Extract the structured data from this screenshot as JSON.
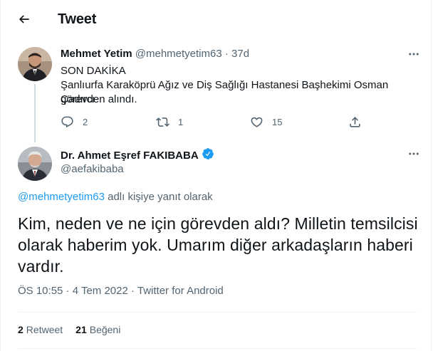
{
  "header": {
    "title": "Tweet",
    "back_icon": "arrow-left-icon"
  },
  "parent_tweet": {
    "name": "Mehmet Yetim",
    "handle": "@mehmetyetim63",
    "separator": " · ",
    "time": "37d",
    "text_lines": [
      "SON DAKİKA",
      "Şanlıurfa Karaköprü Ağız ve Diş Sağlığı Hastanesi Başhekimi Osman Çadırcı",
      "görevden alındı."
    ],
    "replies": "2",
    "retweets": "1",
    "likes": "15"
  },
  "main_tweet": {
    "name": "Dr. Ahmet Eşref FAKIBABA",
    "handle": "@aefakibaba",
    "verified_color": "#1d9bf0",
    "reply_to_handle": "@mehmetyetim63",
    "reply_to_suffix": " adlı kişiye yanıt olarak",
    "text_lines": [
      "Kim, neden ve ne için görevden aldı? Milletin temsilcisi",
      "olarak haberim yok. Umarım diğer arkadaşların haberi",
      "vardır."
    ],
    "meta": "ÖS 10:55 · 4 Tem 2022 · Twitter for Android",
    "retweet_count": "2",
    "retweet_label": "Retweet",
    "like_count": "21",
    "like_label": "Beğeni"
  },
  "colors": {
    "accent": "#1d9bf0",
    "secondary_text": "#536471",
    "primary_text": "#0f1419",
    "divider": "#eff3f4"
  }
}
